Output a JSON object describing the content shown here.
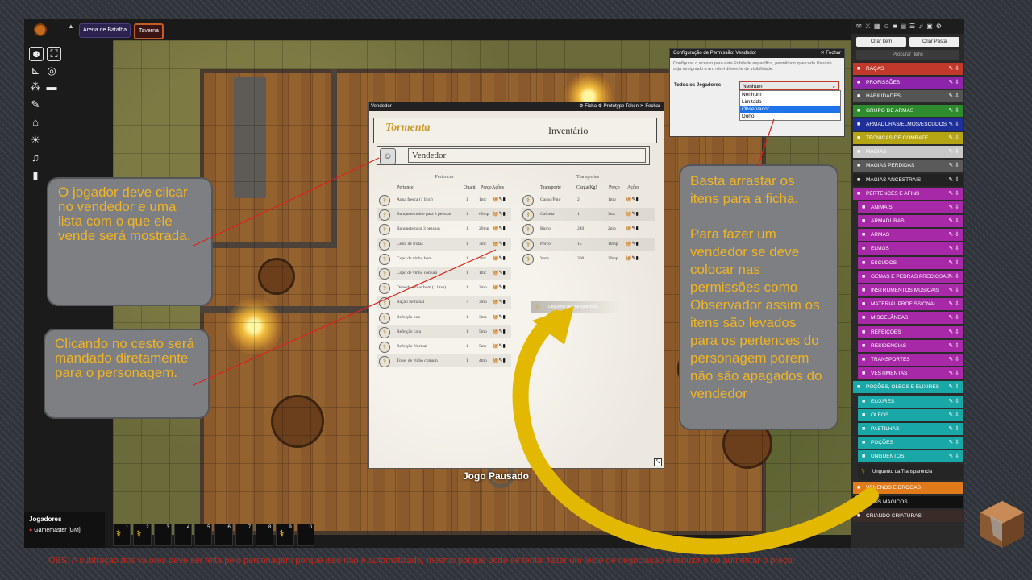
{
  "topbar": {
    "tabs": [
      {
        "label": "Arena de Batalha"
      },
      {
        "label": "Taverna"
      }
    ]
  },
  "players": {
    "title": "Jogadores",
    "gm": "Gamemaster [GM]"
  },
  "macro_bar": {
    "slots": [
      "1",
      "2",
      "3",
      "4",
      "5",
      "6",
      "7",
      "8",
      "9",
      "0"
    ]
  },
  "map": {
    "paused_label": "Jogo Pausado"
  },
  "sheet_dialog": {
    "title": "Vendedor",
    "actions": {
      "ficha": "Ficha",
      "prototype": "Prototype Token",
      "fechar": "Fechar"
    },
    "brand": "Tormenta",
    "heading": "Inventário",
    "name": "Vendedor",
    "pertences": {
      "section_title": "Pertences",
      "headers": {
        "name": "Pertence",
        "qty": "Quant.",
        "price": "Preço",
        "actions": "Ações"
      },
      "rows": [
        {
          "name": "Água fresca (1 litro)",
          "qty": "1",
          "price": "1mc"
        },
        {
          "name": "Banquete nobre para 3 pessoas",
          "qty": "1",
          "price": "60mp"
        },
        {
          "name": "Banquete para 3 pessoas",
          "qty": "1",
          "price": "20mp"
        },
        {
          "name": "Cesta de frutas",
          "qty": "1",
          "price": "3mc"
        },
        {
          "name": "Copo de vinho bom",
          "qty": "1",
          "price": "3mc"
        },
        {
          "name": "Copo de vinho comum",
          "qty": "1",
          "price": "1mc"
        },
        {
          "name": "Odre de vinho bom (1 litro)",
          "qty": "1",
          "price": "3mp"
        },
        {
          "name": "Ração Semanal",
          "qty": "7",
          "price": "3mp"
        },
        {
          "name": "Refeição boa",
          "qty": "1",
          "price": "3mp"
        },
        {
          "name": "Refeição cara",
          "qty": "1",
          "price": "5mp"
        },
        {
          "name": "Refeição Normal",
          "qty": "1",
          "price": "5mc"
        },
        {
          "name": "Tonel de vinho comum",
          "qty": "1",
          "price": "4mp"
        }
      ]
    },
    "transportes": {
      "section_title": "Transportes",
      "headers": {
        "name": "Transporte",
        "load": "Carga(Kg)",
        "price": "Preço",
        "actions": "Ações"
      },
      "rows": [
        {
          "name": "Ganso/Pato",
          "load": "2",
          "price": "1mp"
        },
        {
          "name": "Galinha",
          "load": "1",
          "price": "3mc"
        },
        {
          "name": "Burro",
          "load": "240",
          "price": "2mp"
        },
        {
          "name": "Porco",
          "load": "15",
          "price": "10mp"
        },
        {
          "name": "Vaca",
          "load": "300",
          "price": "30mp"
        }
      ]
    },
    "dragging_item": "Unguento da Transparência"
  },
  "permission_dialog": {
    "title": "Configuração de Permissão: Vendedor",
    "close": "Fechar",
    "description": "Configurar o acesso para esta Entidade específica, permitindo que cada Usuário seja designado a um nível diferente de visibilidade.",
    "label": "Todos os Jogadores",
    "selected": "Nenhum",
    "options": [
      "Nenhum",
      "Limitado",
      "Observador",
      "Dono"
    ]
  },
  "sidebar": {
    "buttons": {
      "create_item": "Criar Item",
      "create_folder": "Criar Pasta"
    },
    "search_placeholder": "Procurar Itens",
    "folders": [
      {
        "label": "RAÇAS",
        "color": "#c0392b",
        "sub": false
      },
      {
        "label": "PROFISSÕES",
        "color": "#8e24aa",
        "sub": false
      },
      {
        "label": "HABILIDADES",
        "color": "#555555",
        "sub": false
      },
      {
        "label": "GRUPO DE ARMAS",
        "color": "#2e8b2e",
        "sub": false
      },
      {
        "label": "ARMADURAS/ELMOS/ESCUDOS",
        "color": "#1f2f9a",
        "sub": false
      },
      {
        "label": "TÉCNICAS DE COMBATE",
        "color": "#b5a515",
        "sub": false
      },
      {
        "label": "MAGIAS",
        "color": "#c8c8c8",
        "sub": false
      },
      {
        "label": "MAGIAS PERDIDAS",
        "color": "#5a5a5a",
        "sub": false
      },
      {
        "label": "MAGIAS ANCESTRAIS",
        "color": "#222222",
        "sub": false
      },
      {
        "label": "PERTENCES E AFINS",
        "color": "#a829a8",
        "sub": false
      },
      {
        "label": "ANIMAIS",
        "color": "#a829a8",
        "sub": true
      },
      {
        "label": "ARMADURAS",
        "color": "#a829a8",
        "sub": true
      },
      {
        "label": "ARMAS",
        "color": "#a829a8",
        "sub": true
      },
      {
        "label": "ELMOS",
        "color": "#a829a8",
        "sub": true
      },
      {
        "label": "ESCUDOS",
        "color": "#a829a8",
        "sub": true
      },
      {
        "label": "GEMAS E PEDRAS PRECIOSAS",
        "color": "#a829a8",
        "sub": true
      },
      {
        "label": "INSTRUMENTOS MUSICAIS",
        "color": "#a829a8",
        "sub": true
      },
      {
        "label": "MATERIAL PROFISSIONAL",
        "color": "#a829a8",
        "sub": true
      },
      {
        "label": "MISCELÂNEAS",
        "color": "#a829a8",
        "sub": true
      },
      {
        "label": "REFEIÇÕES",
        "color": "#a829a8",
        "sub": true
      },
      {
        "label": "RESIDENCIAS",
        "color": "#a829a8",
        "sub": true
      },
      {
        "label": "TRANSPORTES",
        "color": "#a829a8",
        "sub": true
      },
      {
        "label": "VESTIMENTAS",
        "color": "#a829a8",
        "sub": true
      },
      {
        "label": "POÇÕES, OLEOS E ELIXIRES",
        "color": "#1aa7a7",
        "sub": false
      },
      {
        "label": "ELIXIRES",
        "color": "#1aa7a7",
        "sub": true
      },
      {
        "label": "OLEOS",
        "color": "#1aa7a7",
        "sub": true
      },
      {
        "label": "PASTILHAS",
        "color": "#1aa7a7",
        "sub": true
      },
      {
        "label": "POÇÕES",
        "color": "#1aa7a7",
        "sub": true
      },
      {
        "label": "UNGUENTOS",
        "color": "#1aa7a7",
        "sub": true
      }
    ],
    "item": "Unguento da Transparência",
    "bottom_folders": [
      {
        "label": "VENENOS E DROGAS",
        "color": "#e07a1a"
      },
      {
        "label": "ITENS MAGICOS",
        "color": "#111111"
      },
      {
        "label": "CRIANDO CRIATURAS",
        "color": "#3a2a28"
      }
    ]
  },
  "callouts": {
    "vendor": "O jogador deve clicar no vendedor e uma lista com o que ele vende será mostrada.",
    "basket": "Clicando no cesto será mandado diretamente para o personagem.",
    "drag_a": "Basta arrastar os itens para a ficha.",
    "drag_b": "Para fazer um vendedor se deve colocar nas permissões como Observador assim os itens são levados para os pertences do personagem porem não são apagados do vendedor"
  },
  "footnote": "OBS: A subtração dos valores deve ser feita pelo personagem porque isso não é automatizado, mesmo porque pode se tentar fazer um teste de negociação e reduzir o ou aumentar o preço.",
  "colors": {
    "accent": "#f0b424",
    "arrow": "#e3b800",
    "annotation_line": "#e0201a"
  }
}
